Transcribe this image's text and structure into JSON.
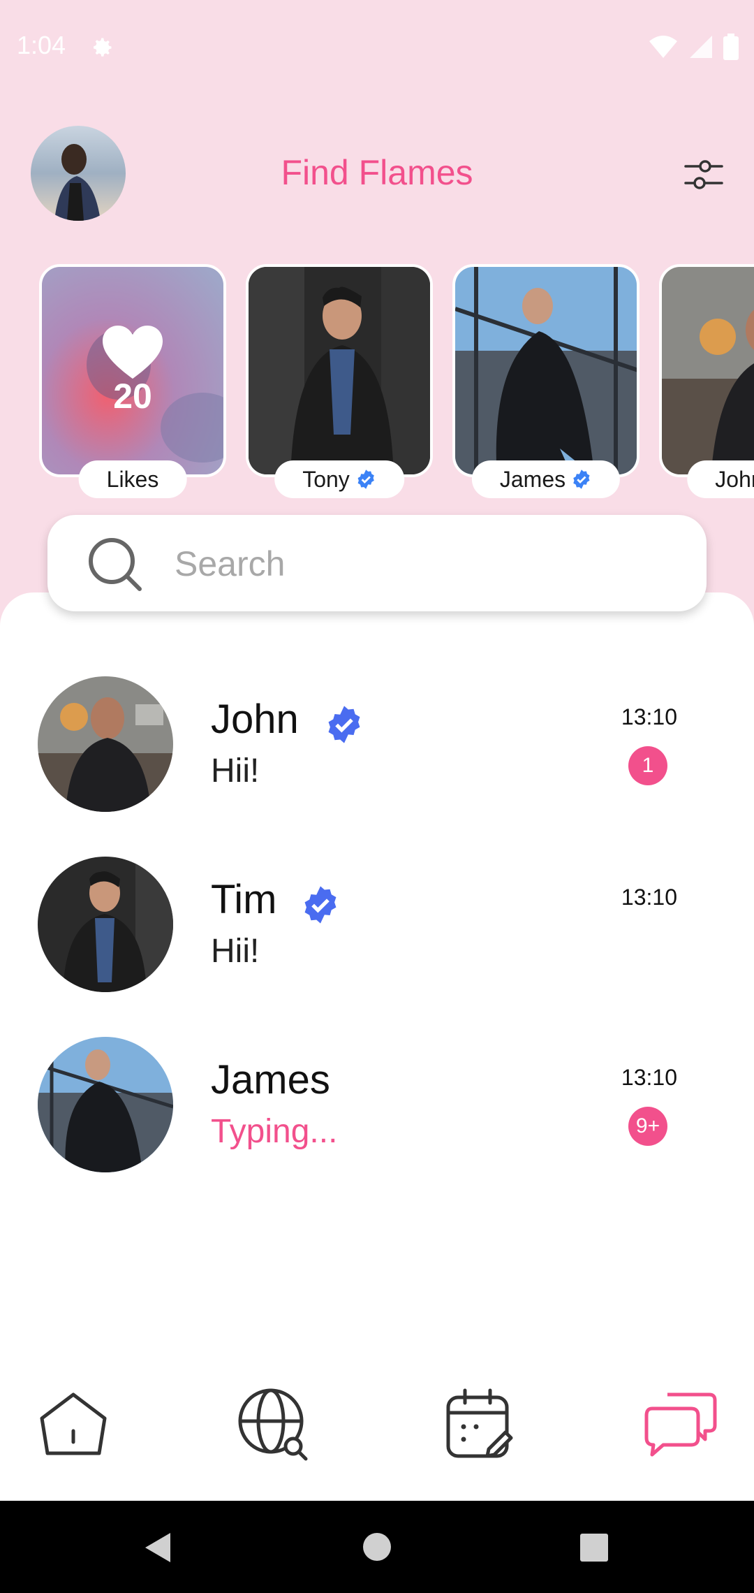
{
  "status_bar": {
    "time": "1:04"
  },
  "header": {
    "title": "Find Flames"
  },
  "stories": [
    {
      "label": "Likes",
      "count": "20",
      "verified": false
    },
    {
      "label": "Tony",
      "verified": true
    },
    {
      "label": "James",
      "verified": true
    },
    {
      "label": "John",
      "verified": true
    }
  ],
  "search": {
    "placeholder": "Search"
  },
  "chats": [
    {
      "name": "John",
      "verified": true,
      "message": "Hii!",
      "time": "13:10",
      "unread": "1"
    },
    {
      "name": "Tim",
      "verified": true,
      "message": "Hii!",
      "time": "13:10",
      "unread": ""
    },
    {
      "name": "James",
      "verified": false,
      "message": "Typing...",
      "time": "13:10",
      "unread": "9+"
    }
  ],
  "nav": [
    "home-icon",
    "globe-search-icon",
    "calendar-edit-icon",
    "chat-bubbles-icon"
  ],
  "colors": {
    "accent": "#f2508c",
    "background": "#f9dde7",
    "verified": "#4a6cf0"
  }
}
